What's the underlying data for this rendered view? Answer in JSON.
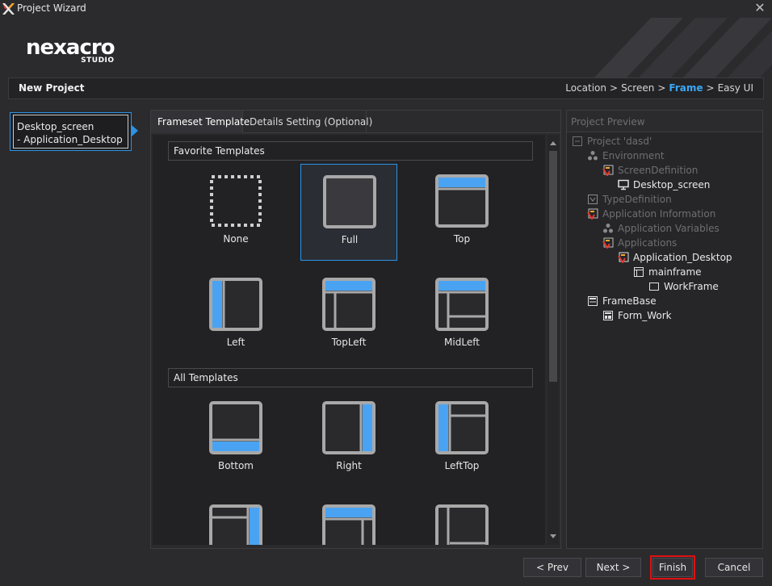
{
  "window": {
    "title": "Project Wizard"
  },
  "logo": {
    "word": "nexacro",
    "sub": "STUDIO"
  },
  "step": {
    "heading": "New Project",
    "crumbs": [
      "Location",
      "Screen",
      "Frame",
      "Easy UI"
    ],
    "active_crumb": "Frame",
    "separator": ">"
  },
  "project_list": [
    {
      "line1": "Desktop_screen",
      "line2": " - Application_Desktop"
    }
  ],
  "tabs": [
    {
      "label": "Frameset Template",
      "active": true
    },
    {
      "label": "Details Setting (Optional)",
      "active": false
    }
  ],
  "sections": {
    "favorite": "Favorite Templates",
    "all": "All Templates"
  },
  "favorite_templates": [
    "None",
    "Full",
    "Top",
    "Left",
    "TopLeft",
    "MidLeft"
  ],
  "all_templates": [
    "Bottom",
    "Right",
    "LeftTop"
  ],
  "selected_template": "Full",
  "preview": {
    "title": "Project Preview",
    "tree": [
      {
        "label": "Project 'dasd'",
        "icon": "project-icon",
        "depth": 0,
        "dim": true
      },
      {
        "label": "Environment",
        "icon": "environment-icon",
        "depth": 1,
        "dim": true
      },
      {
        "label": "ScreenDefinition",
        "icon": "definition-icon",
        "depth": 2,
        "dim": true
      },
      {
        "label": "Desktop_screen",
        "icon": "monitor-icon",
        "depth": 3,
        "dim": false
      },
      {
        "label": "TypeDefinition",
        "icon": "type-definition-icon",
        "depth": 1,
        "dim": true
      },
      {
        "label": "Application Information",
        "icon": "definition-icon",
        "depth": 1,
        "dim": true
      },
      {
        "label": "Application Variables",
        "icon": "environment-icon",
        "depth": 2,
        "dim": true
      },
      {
        "label": "Applications",
        "icon": "definition-icon",
        "depth": 2,
        "dim": true
      },
      {
        "label": "Application_Desktop",
        "icon": "definition-icon",
        "depth": 3,
        "dim": false
      },
      {
        "label": "mainframe",
        "icon": "frame-icon",
        "depth": 4,
        "dim": false
      },
      {
        "label": "WorkFrame",
        "icon": "workframe-icon",
        "depth": 5,
        "dim": false
      },
      {
        "label": "FrameBase",
        "icon": "formbase-icon",
        "depth": 1,
        "dim": false
      },
      {
        "label": "Form_Work",
        "icon": "form-icon",
        "depth": 2,
        "dim": false
      }
    ]
  },
  "buttons": {
    "prev": "< Prev",
    "next": "Next >",
    "finish": "Finish",
    "cancel": "Cancel"
  },
  "colors": {
    "accent": "#2c93e6",
    "template_fill": "#4aa3f2",
    "template_frame": "#a8a8a8",
    "highlight": "#e01010"
  }
}
